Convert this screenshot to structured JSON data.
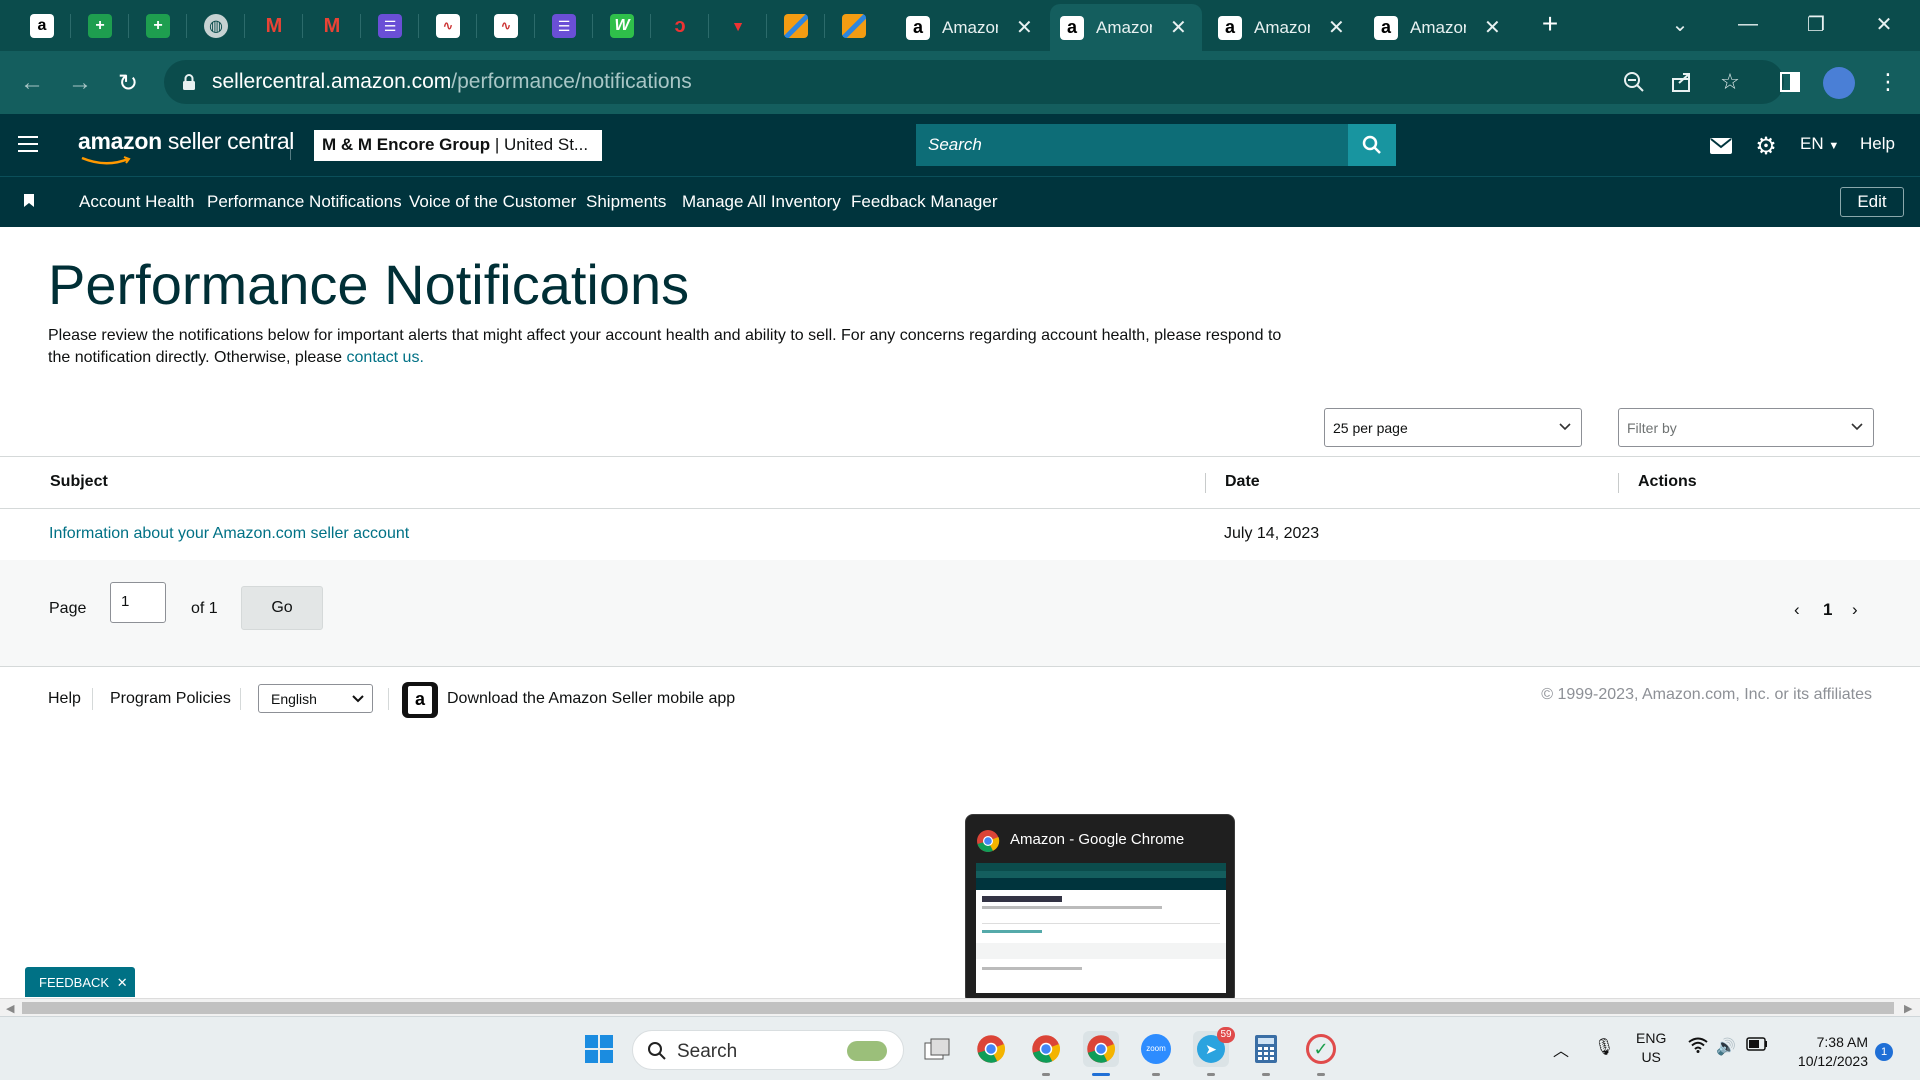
{
  "browser": {
    "tabs": [
      {
        "title": "Amazon",
        "active": false
      },
      {
        "title": "Amazon",
        "active": true
      },
      {
        "title": "Amazon",
        "active": false
      },
      {
        "title": "Amazon",
        "active": false
      }
    ],
    "url_host": "sellercentral.amazon.com",
    "url_path": "/performance/notifications"
  },
  "header": {
    "logo_bold": "amazon",
    "logo_rest": " seller central",
    "account_name": "M & M Encore Group",
    "account_region": " | United St...",
    "search_placeholder": "Search",
    "language": "EN",
    "help": "Help"
  },
  "bookmarks": {
    "items": [
      "Account Health",
      "Performance Notifications",
      "Voice of the Customer",
      "Shipments",
      "Manage All Inventory",
      "Feedback Manager"
    ],
    "edit_label": "Edit"
  },
  "page": {
    "title": "Performance Notifications",
    "description": "Please review the notifications below for important alerts that might affect your account health and ability to sell. For any concerns regarding account health, please respond to the notification directly. Otherwise, please ",
    "contact_link": "contact us.",
    "per_page": "25 per page",
    "filter_placeholder": "Filter by"
  },
  "table": {
    "headers": {
      "subject": "Subject",
      "date": "Date",
      "actions": "Actions"
    },
    "rows": [
      {
        "subject": "Information about your Amazon.com seller account",
        "date": "July 14, 2023",
        "actions": ""
      }
    ]
  },
  "pagination": {
    "page_label": "Page",
    "page_value": "1",
    "of_label": "of 1",
    "go_label": "Go",
    "current": "1"
  },
  "footer": {
    "help": "Help",
    "policies": "Program Policies",
    "language": "English",
    "app_text": "Download the Amazon Seller mobile app",
    "copyright": "© 1999-2023, Amazon.com, Inc. or its affiliates"
  },
  "feedback_label": "FEEDBACK",
  "preview": {
    "title": "Amazon - Google Chrome"
  },
  "taskbar": {
    "search_label": "Search",
    "telegram_badge": "59",
    "lang_top": "ENG",
    "lang_bottom": "US",
    "time": "7:38 AM",
    "date": "10/12/2023",
    "notification_count": "1"
  },
  "colors": {
    "chrome_dark": "#0b4c4c",
    "chrome_toolbar": "#145e5e",
    "seller_header": "#00343d",
    "link": "#007185"
  }
}
